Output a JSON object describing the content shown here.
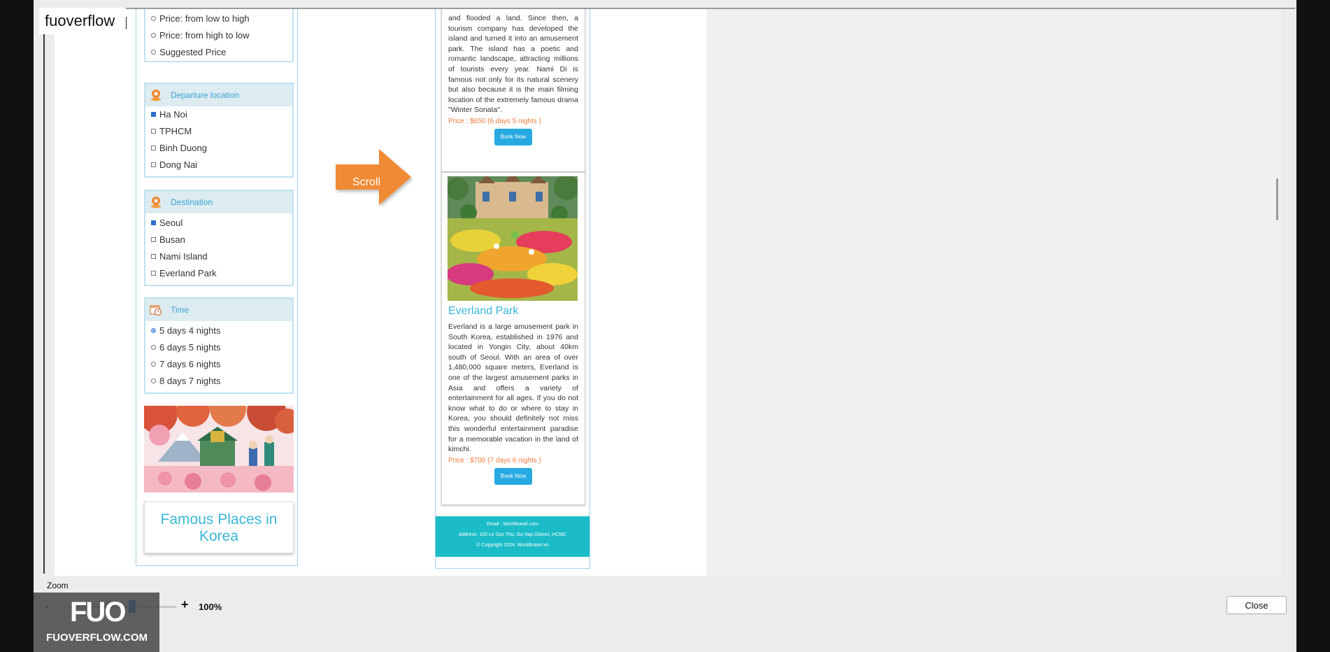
{
  "brand": {
    "name": "fuoverflow"
  },
  "sort": {
    "options": [
      {
        "label": "Price: from low to high"
      },
      {
        "label": "Price: from high to low"
      },
      {
        "label": "Suggested Price"
      }
    ]
  },
  "departure": {
    "title": "Departure location",
    "options": [
      {
        "label": "Ha Noi",
        "checked": true
      },
      {
        "label": "TPHCM",
        "checked": false
      },
      {
        "label": "Binh Duong",
        "checked": false
      },
      {
        "label": "Dong Nai",
        "checked": false
      }
    ]
  },
  "destination": {
    "title": "Destination",
    "options": [
      {
        "label": "Seoul",
        "checked": true
      },
      {
        "label": "Busan",
        "checked": false
      },
      {
        "label": "Nami Island",
        "checked": false
      },
      {
        "label": "Everland Park",
        "checked": false
      }
    ]
  },
  "time": {
    "title": "Time",
    "options": [
      {
        "label": "5 days 4 nights",
        "selected": true
      },
      {
        "label": "6 days 5 nights",
        "selected": false
      },
      {
        "label": "7 days 6 nights",
        "selected": false
      },
      {
        "label": "8 days 7 nights",
        "selected": false
      }
    ]
  },
  "famous": {
    "title": "Famous Places in Korea"
  },
  "arrow": {
    "label": "Scroll",
    "color": "#f08a35"
  },
  "nami": {
    "description": "and flooded a land. Since then, a tourism company has developed the island and turned it into an amusement park. The island has a poetic and romantic landscape, attracting millions of tourists every year. Nami Di is famous not only for its natural scenery but also because it is the main filming location of the extremely famous drama \"Winter Sonata\".",
    "price": "Price : $650 (6 days 5 nights )",
    "button": "Book Now"
  },
  "everland": {
    "title": "Everland Park",
    "description": "Everland is a large amusement park in South Korea, established in 1976 and located in Yongin City, about 40km south of Seoul. With an area of over 1,480,000 square meters, Everland is one of the largest amusement parks in Asia and offers a variety of entertainment for all ages. If you do not know what to do or where to stay in Korea, you should definitely not miss this wonderful entertainment paradise for a memorable vacation in the land of kimchi.",
    "price": "Price : $700 (7 days 6 nights )",
    "button": "Book Now"
  },
  "footer": {
    "email": "Email : Worldtravel.com",
    "address": "Address: 100 Le Duc Tho, Go Vap District, HCMC",
    "copyright": "© Copyright 2024. Worldtravel.vn"
  },
  "zoom": {
    "label": "Zoom",
    "minus": "-",
    "plus": "+",
    "value": "100%",
    "level_percent": 100
  },
  "close_button": "Close",
  "watermark": {
    "logo": "FUO",
    "text": "FUOVERFLOW.COM"
  },
  "colors": {
    "accent": "#39b6d8",
    "header_bg": "#dcecf1",
    "price": "#f07b3c",
    "button": "#27a9e1",
    "footer": "#1bbcc7"
  }
}
